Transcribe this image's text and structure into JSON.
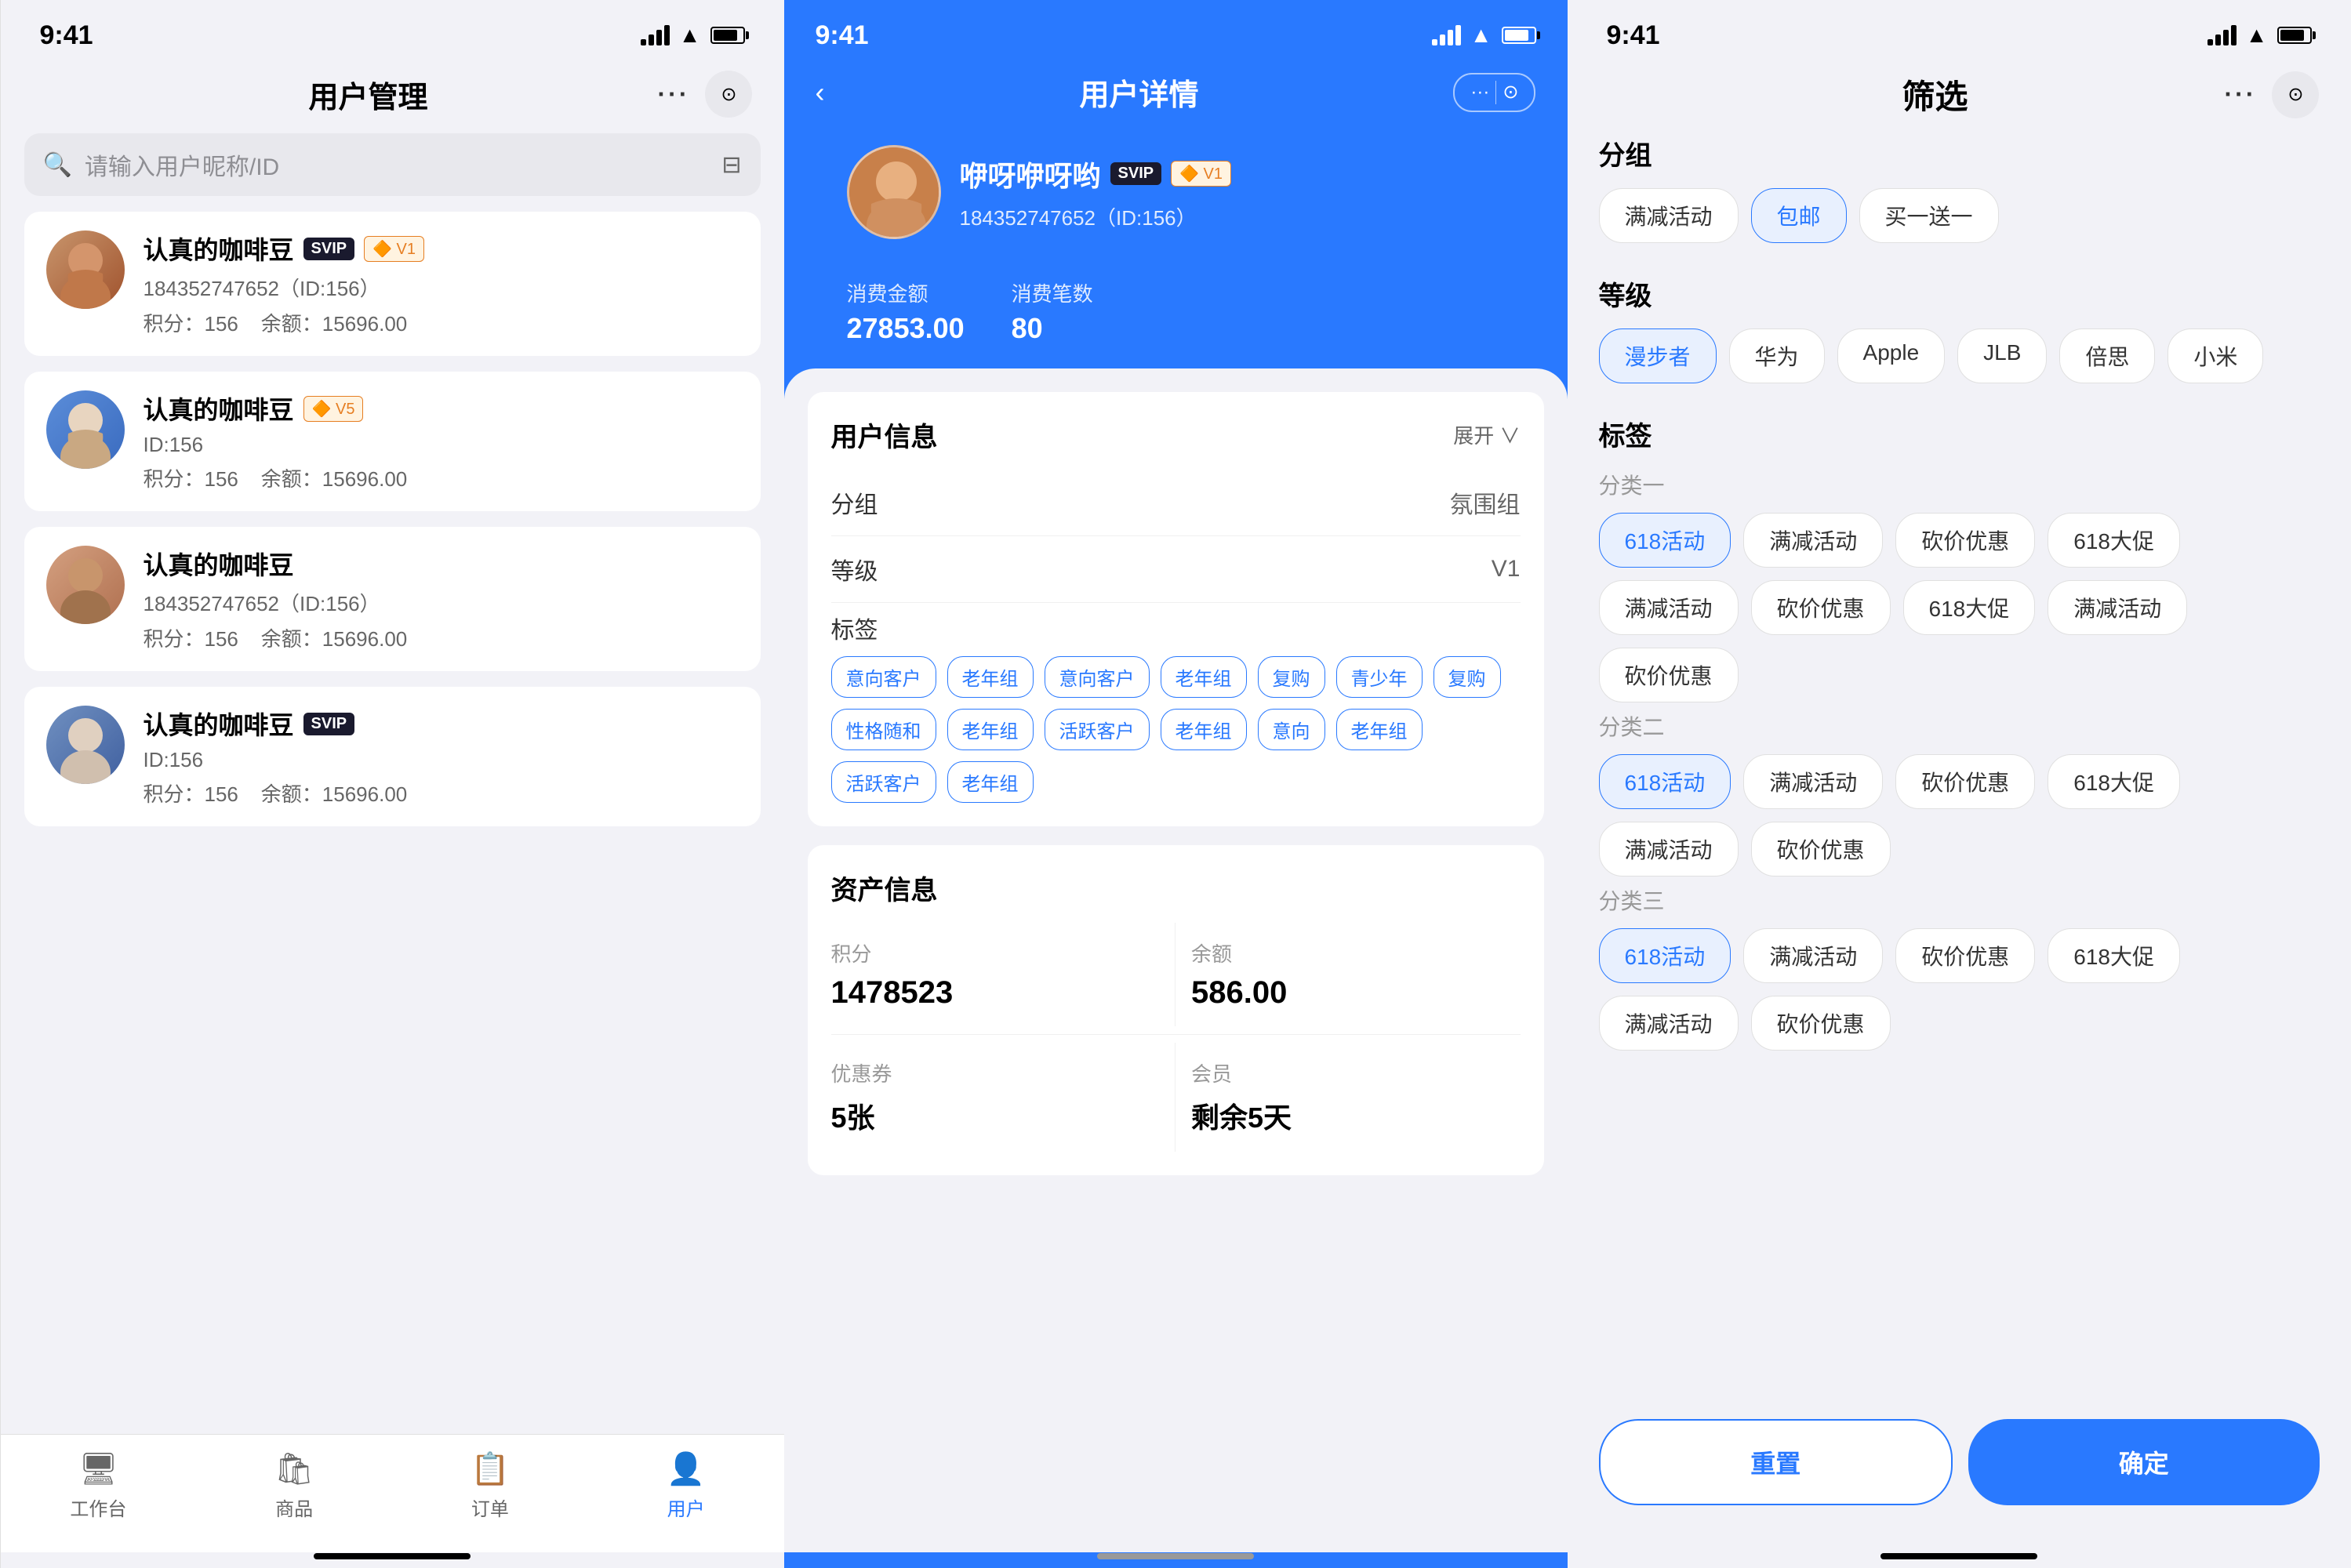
{
  "phone1": {
    "status": {
      "time": "9:41"
    },
    "nav": {
      "title": "用户管理",
      "dots": "···"
    },
    "search": {
      "placeholder": "请输入用户昵称/ID"
    },
    "users": [
      {
        "name": "认真的咖啡豆",
        "badges": [
          "SVIP",
          "V1"
        ],
        "id_text": "184352747652（ID:156）",
        "points": "积分：156",
        "balance": "余额：15696.00",
        "avatar_type": "brown"
      },
      {
        "name": "认真的咖啡豆",
        "badges": [
          "V5"
        ],
        "id_text": "ID:156",
        "points": "积分：156",
        "balance": "余额：15696.00",
        "avatar_type": "blue"
      },
      {
        "name": "认真的咖啡豆",
        "badges": [],
        "id_text": "184352747652（ID:156）",
        "points": "积分：156",
        "balance": "余额：15696.00",
        "avatar_type": "gray"
      },
      {
        "name": "认真的咖啡豆",
        "badges": [
          "SVIP"
        ],
        "id_text": "ID:156",
        "points": "积分：156",
        "balance": "余额：15696.00",
        "avatar_type": "user4"
      }
    ],
    "tabs": [
      {
        "icon": "🖥",
        "label": "工作台",
        "active": false
      },
      {
        "icon": "🛍",
        "label": "商品",
        "active": false
      },
      {
        "icon": "📋",
        "label": "订单",
        "active": false
      },
      {
        "icon": "👤",
        "label": "用户",
        "active": true
      }
    ]
  },
  "phone2": {
    "status": {
      "time": "9:41"
    },
    "nav": {
      "title": "用户详情",
      "dots": "···"
    },
    "user": {
      "name": "咿呀咿呀哟",
      "badges": [
        "SVIP",
        "V1"
      ],
      "id_text": "184352747652（ID:156）",
      "consume_amount_label": "消费金额",
      "consume_amount": "27853.00",
      "consume_count_label": "消费笔数",
      "consume_count": "80"
    },
    "info_section": {
      "title": "用户信息",
      "expand": "展开",
      "rows": [
        {
          "key": "分组",
          "value": "氛围组"
        },
        {
          "key": "等级",
          "value": "V1"
        }
      ],
      "tags_label": "标签",
      "tags": [
        "意向客户",
        "老年组",
        "意向客户",
        "老年组",
        "复购",
        "青少年",
        "复购",
        "性格随和",
        "老年组",
        "活跃客户",
        "老年组",
        "意向",
        "老年组",
        "活跃客户",
        "老年组"
      ]
    },
    "asset_section": {
      "title": "资产信息",
      "points_label": "积分",
      "points_value": "1478523",
      "balance_label": "余额",
      "balance_value": "586.00",
      "coupon_label": "优惠券",
      "coupon_value": "5张",
      "member_label": "会员",
      "member_value": "剩余5天"
    }
  },
  "phone3": {
    "status": {
      "time": "9:41"
    },
    "nav": {
      "title": "筛选",
      "dots": "···"
    },
    "sections": [
      {
        "title": "分组",
        "chips": [
          {
            "label": "满减活动",
            "active": false
          },
          {
            "label": "包邮",
            "active": true
          },
          {
            "label": "买一送一",
            "active": false
          }
        ]
      },
      {
        "title": "等级",
        "chips": [
          {
            "label": "漫步者",
            "active": true
          },
          {
            "label": "华为",
            "active": false
          },
          {
            "label": "Apple",
            "active": false
          },
          {
            "label": "JLB",
            "active": false
          },
          {
            "label": "倍思",
            "active": false
          },
          {
            "label": "小米",
            "active": false
          }
        ]
      }
    ],
    "tags_section": {
      "title": "标签",
      "subsections": [
        {
          "label": "分类一",
          "chips": [
            {
              "label": "618活动",
              "active": true
            },
            {
              "label": "满减活动",
              "active": false
            },
            {
              "label": "砍价优惠",
              "active": false
            },
            {
              "label": "618大促",
              "active": false
            },
            {
              "label": "满减活动",
              "active": false
            },
            {
              "label": "砍价优惠",
              "active": false
            },
            {
              "label": "618大促",
              "active": false
            },
            {
              "label": "满减活动",
              "active": false
            },
            {
              "label": "砍价优惠",
              "active": false
            }
          ]
        },
        {
          "label": "分类二",
          "chips": [
            {
              "label": "618活动",
              "active": true
            },
            {
              "label": "满减活动",
              "active": false
            },
            {
              "label": "砍价优惠",
              "active": false
            },
            {
              "label": "618大促",
              "active": false
            },
            {
              "label": "满减活动",
              "active": false
            },
            {
              "label": "砍价优惠",
              "active": false
            }
          ]
        },
        {
          "label": "分类三",
          "chips": [
            {
              "label": "618活动",
              "active": true
            },
            {
              "label": "满减活动",
              "active": false
            },
            {
              "label": "砍价优惠",
              "active": false
            },
            {
              "label": "618大促",
              "active": false
            },
            {
              "label": "满减活动",
              "active": false
            },
            {
              "label": "砍价优惠",
              "active": false
            }
          ]
        }
      ]
    },
    "footer": {
      "reset": "重置",
      "confirm": "确定"
    }
  }
}
